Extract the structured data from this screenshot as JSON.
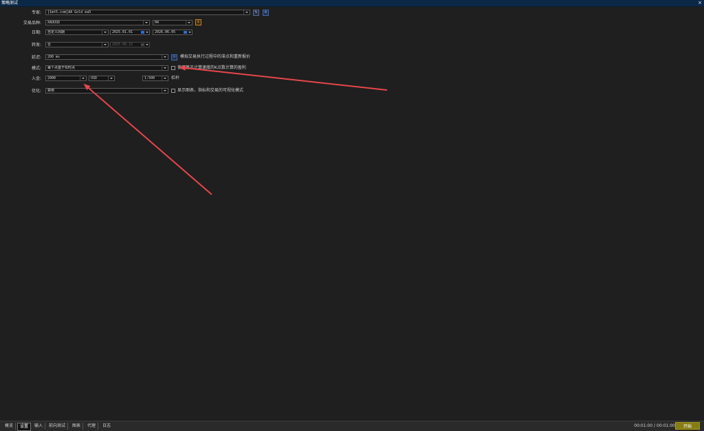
{
  "window": {
    "title": "策略测试",
    "close_icon": "×"
  },
  "form": {
    "expert": {
      "label": "专家:",
      "value": "[1mt5.com]AA Gold ea5"
    },
    "symbol": {
      "label": "交易品种:",
      "value": "XAUUSD",
      "timeframe": "H4"
    },
    "date": {
      "label": "日期:",
      "period": "自定义周期",
      "from": "2025.01.01",
      "to": "2026.06.05"
    },
    "forward": {
      "label": "转发:",
      "value": "否",
      "date": "2025.08.22"
    },
    "delay": {
      "label": "延迟:",
      "value": "200 ms",
      "note": "模拟交易执行过程中的滞点和重新报价"
    },
    "model": {
      "label": "模式:",
      "value": "每个点基于实时点",
      "note": "使用基于计算速度的K点数计算的盈利"
    },
    "deposit": {
      "label": "入金:",
      "value": "2000",
      "currency": "USD",
      "leverage": "1:500",
      "leverage_label": "杠杆"
    },
    "optimization": {
      "label": "优化:",
      "value": "禁用",
      "note": "显示图表，指标和交易的可视化模式"
    }
  },
  "tabs": [
    {
      "label": "概览"
    },
    {
      "label": "设置",
      "active": true
    },
    {
      "label": "输入"
    },
    {
      "label": "前向测试"
    },
    {
      "label": "图表"
    },
    {
      "label": "代理"
    },
    {
      "label": "日志"
    }
  ],
  "footer": {
    "time": "00:01:00 / 00:01:00",
    "start": "开始"
  },
  "colors": {
    "annotation_arrow": "#e8464b",
    "accent": "#857d15",
    "titlebar": "#0c2847"
  }
}
